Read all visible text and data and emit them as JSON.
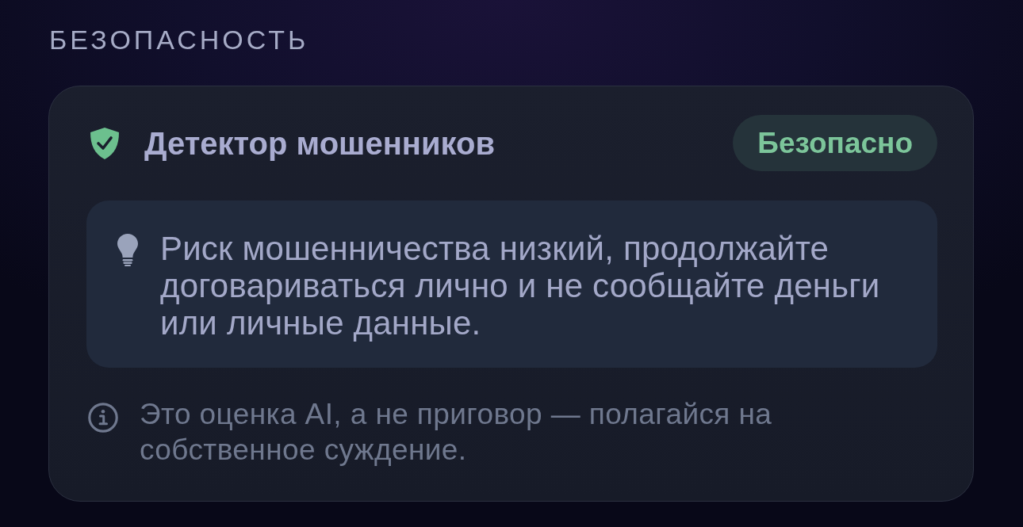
{
  "section": {
    "title": "БЕЗОПАСНОСТЬ"
  },
  "card": {
    "title": "Детектор мошенников",
    "status": {
      "label": "Безопасно",
      "kind": "safe"
    },
    "tip": {
      "text": "Риск мошенничества низкий, продолжайте договариваться лично и не сообщайте деньги или личные данные."
    },
    "note": {
      "text": "Это оценка AI, а не приговор — полагайся на собственное суждение."
    }
  }
}
